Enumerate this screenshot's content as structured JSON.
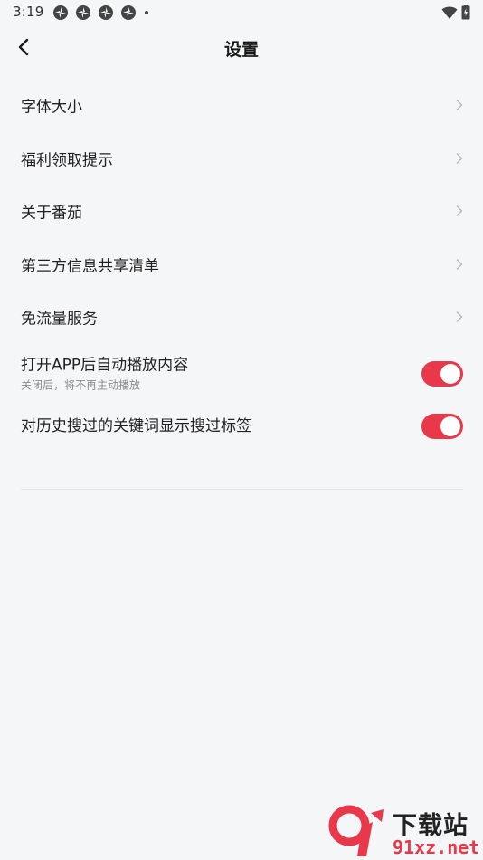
{
  "status_bar": {
    "time": "3:19",
    "notification_icons": [
      "app-notification-icon",
      "app-notification-icon",
      "app-notification-icon",
      "app-notification-icon"
    ],
    "wifi_icon": "wifi-icon",
    "battery_icon": "battery-icon"
  },
  "header": {
    "title": "设置",
    "back_icon": "chevron-left-icon"
  },
  "settings": {
    "items": [
      {
        "label": "字体大小"
      },
      {
        "label": "福利领取提示"
      },
      {
        "label": "关于番茄"
      },
      {
        "label": "第三方信息共享清单"
      },
      {
        "label": "免流量服务"
      }
    ],
    "toggles": [
      {
        "label": "打开APP后自动播放内容",
        "sublabel": "关闭后，将不再主动播放",
        "on": true
      },
      {
        "label": "对历史搜过的关键词显示搜过标签",
        "on": true
      }
    ]
  },
  "watermark": {
    "title": "下载站",
    "domain": "91xz.net"
  },
  "colors": {
    "background": "#f5f6f8",
    "accent": "#e8384a",
    "text_primary": "#222222",
    "text_secondary": "#8a8a8a"
  }
}
